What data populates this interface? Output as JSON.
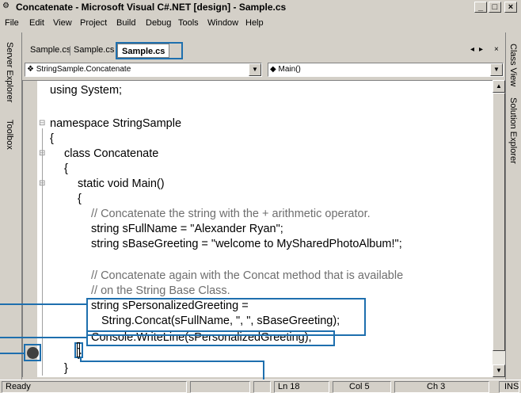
{
  "window": {
    "title": "Concatenate - Microsoft Visual C#.NET [design] - Sample.cs",
    "controls": [
      "_",
      "□",
      "×"
    ]
  },
  "menu": [
    "File",
    "Edit",
    "View",
    "Project",
    "Build",
    "Debug",
    "Tools",
    "Window",
    "Help"
  ],
  "left_panels": [
    "Server Explorer",
    "Toolbox"
  ],
  "right_panels": [
    "Class View",
    "Solution Explorer"
  ],
  "tabs": [
    "Sample.cs",
    "Sample.cs",
    "Sample.cs"
  ],
  "tab_nav": [
    "◂",
    "▸",
    "×"
  ],
  "type_combo": "StringSample.Concatenate",
  "member_combo": "Main()",
  "code": {
    "line1": "using System;",
    "line2": "namespace StringSample",
    "line3": "{",
    "line4": "class Concatenate",
    "line5": "{",
    "line6": "static void Main()",
    "line7": "{",
    "line8": "// Concatenate the string with the + arithmetic operator.",
    "line9": "string sFullName = \"Alexander Ryan\";",
    "line10": "string sBaseGreeting = \"welcome to MySharedPhotoAlbum!\";",
    "line11": "// Concatenate again with the Concat method that is available",
    "line12": "// on the String Base Class.",
    "line13": "string sPersonalizedGreeting =",
    "line14": "String.Concat(sFullName, \", \", sBaseGreeting);",
    "line15": "Console.WriteLine(sPersonalizedGreeting);",
    "line16": "}",
    "line17": "}"
  },
  "status": {
    "ready": "Ready",
    "ln": "Ln 18",
    "col": "Col 5",
    "ch": "Ch 3",
    "ins": "INS"
  },
  "colors": {
    "callout": "#1e6fae",
    "chrome": "#d4d0c8"
  }
}
